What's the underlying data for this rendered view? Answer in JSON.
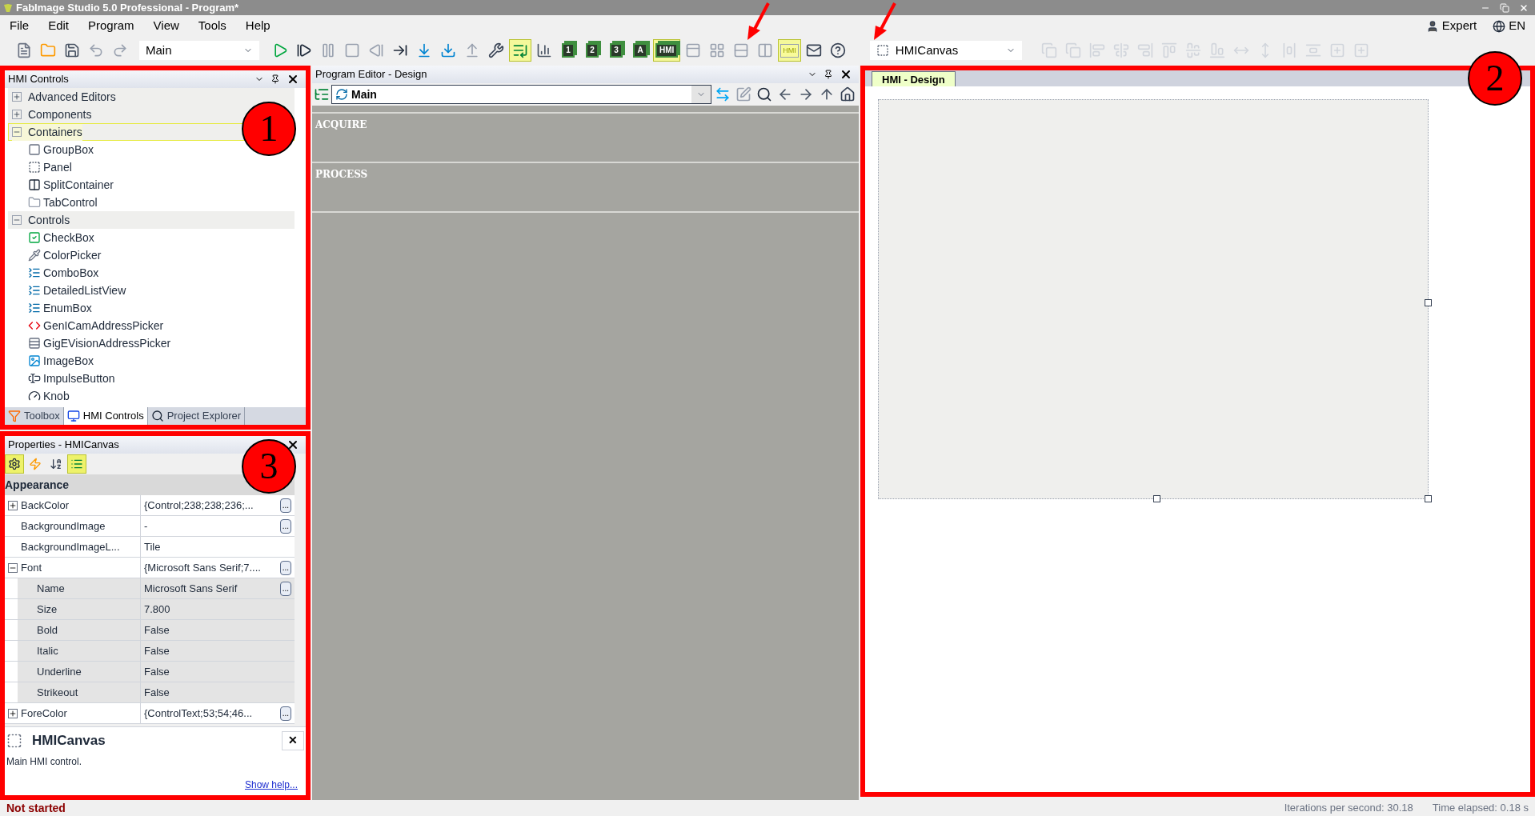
{
  "window": {
    "title": "FabImage Studio 5.0 Professional - Program*"
  },
  "menu": [
    "File",
    "Edit",
    "Program",
    "View",
    "Tools",
    "Help"
  ],
  "user": {
    "role": "Expert",
    "language": "EN"
  },
  "toolbar": {
    "left": [
      {
        "kind": "new",
        "selected": false
      },
      {
        "kind": "open",
        "selected": false
      },
      {
        "kind": "save",
        "selected": false
      },
      {
        "kind": "undo",
        "selected": false
      },
      {
        "kind": "redo",
        "selected": false
      }
    ],
    "program_dropdown": "Main",
    "middle": [
      {
        "kind": "run",
        "selected": false
      },
      {
        "kind": "step",
        "selected": false
      },
      {
        "kind": "pause",
        "selected": false
      },
      {
        "kind": "stop",
        "selected": false
      },
      {
        "kind": "back",
        "selected": false
      },
      {
        "kind": "iterate",
        "selected": false
      },
      {
        "kind": "step_in",
        "selected": false
      },
      {
        "kind": "step_over",
        "selected": false
      },
      {
        "kind": "step_out",
        "selected": false
      },
      {
        "kind": "wrench",
        "selected": false
      },
      {
        "kind": "export",
        "selected": true
      },
      {
        "kind": "chart",
        "selected": false
      },
      {
        "kind": "layout",
        "label": "1",
        "selected": false
      },
      {
        "kind": "layout",
        "label": "2",
        "selected": false
      },
      {
        "kind": "layout",
        "label": "3",
        "selected": false
      },
      {
        "kind": "layout",
        "label": "A",
        "selected": false
      },
      {
        "kind": "layout",
        "label": "HMI",
        "selected": true
      },
      {
        "kind": "single",
        "selected": false
      },
      {
        "kind": "grid",
        "selected": false
      },
      {
        "kind": "rows",
        "selected": false
      },
      {
        "kind": "cols",
        "selected": false
      },
      {
        "kind": "hmi_view",
        "label": "HMI",
        "selected": true
      },
      {
        "kind": "mail",
        "selected": false
      },
      {
        "kind": "help",
        "selected": false
      }
    ],
    "object_dropdown": "HMICanvas",
    "right": [
      {
        "kind": "front",
        "selected": false
      },
      {
        "kind": "back_order",
        "selected": false
      },
      {
        "kind": "align_left",
        "selected": false
      },
      {
        "kind": "align_center",
        "selected": false
      },
      {
        "kind": "align_right",
        "selected": false
      },
      {
        "kind": "align_top",
        "selected": false
      },
      {
        "kind": "align_middle",
        "selected": false
      },
      {
        "kind": "align_bottom",
        "selected": false
      },
      {
        "kind": "same_width",
        "selected": false
      },
      {
        "kind": "same_height",
        "selected": false
      },
      {
        "kind": "space_h",
        "selected": false
      },
      {
        "kind": "space_v",
        "selected": false
      },
      {
        "kind": "center_h",
        "selected": false
      },
      {
        "kind": "center_v",
        "selected": false
      }
    ]
  },
  "hmi_controls": {
    "title": "HMI Controls",
    "groups": [
      {
        "label": "Advanced Editors",
        "expanded": false,
        "selected": false
      },
      {
        "label": "Components",
        "expanded": false,
        "selected": false
      },
      {
        "label": "Containers",
        "expanded": true,
        "selected": true,
        "children": [
          {
            "label": "GroupBox",
            "kind": "groupbox"
          },
          {
            "label": "Panel",
            "kind": "panel"
          },
          {
            "label": "SplitContainer",
            "kind": "split"
          },
          {
            "label": "TabControl",
            "kind": "tab"
          }
        ]
      },
      {
        "label": "Controls",
        "expanded": true,
        "selected": false,
        "children": [
          {
            "label": "CheckBox",
            "kind": "checkbox"
          },
          {
            "label": "ColorPicker",
            "kind": "colorpicker"
          },
          {
            "label": "ComboBox",
            "kind": "list"
          },
          {
            "label": "DetailedListView",
            "kind": "list"
          },
          {
            "label": "EnumBox",
            "kind": "list"
          },
          {
            "label": "GenICamAddressPicker",
            "kind": "code"
          },
          {
            "label": "GigEVisionAddressPicker",
            "kind": "striped"
          },
          {
            "label": "ImageBox",
            "kind": "image"
          },
          {
            "label": "ImpulseButton",
            "kind": "textbox"
          },
          {
            "label": "Knob",
            "kind": "dial"
          }
        ]
      }
    ],
    "tabs": [
      {
        "label": "Toolbox",
        "kind": "funnel",
        "selected": false
      },
      {
        "label": "HMI Controls",
        "kind": "monitor",
        "selected": true
      },
      {
        "label": "Project Explorer",
        "kind": "magnifier",
        "selected": false
      }
    ]
  },
  "properties": {
    "title": "Properties - HMICanvas",
    "toolbar": [
      {
        "kind": "gear",
        "selected": true
      },
      {
        "kind": "lightning",
        "selected": false
      },
      {
        "kind": "sort",
        "selected": false
      },
      {
        "kind": "categorized",
        "selected": true
      }
    ],
    "category": "Appearance",
    "rows": [
      {
        "name": "BackColor",
        "value": "{Control;238;238;236;...",
        "expanded": false,
        "button": "..."
      },
      {
        "name": "BackgroundImage",
        "value": "-",
        "button": "..."
      },
      {
        "name": "BackgroundImageL...",
        "value": "Tile"
      },
      {
        "name": "Font",
        "value": "{Microsoft Sans Serif;7....",
        "expanded": true,
        "button": "...",
        "children": [
          {
            "name": "Name",
            "value": "Microsoft Sans Serif",
            "button": "..."
          },
          {
            "name": "Size",
            "value": "7.800"
          },
          {
            "name": "Bold",
            "value": "False"
          },
          {
            "name": "Italic",
            "value": "False"
          },
          {
            "name": "Underline",
            "value": "False"
          },
          {
            "name": "Strikeout",
            "value": "False"
          }
        ]
      },
      {
        "name": "ForeColor",
        "value": "{ControlText;53;54;46...",
        "expanded": false,
        "button": "..."
      }
    ],
    "description": {
      "title": "HMICanvas",
      "close": "✕",
      "text": "Main HMI control.",
      "link": "Show help..."
    }
  },
  "program_editor": {
    "title": "Program Editor - Design",
    "dropdown": "Main",
    "sections": [
      "ACQUIRE",
      "PROCESS"
    ]
  },
  "hmi_design": {
    "tabs": [
      {
        "label": "HMI - Design",
        "selected": true
      }
    ]
  },
  "annotations": [
    {
      "label": "1"
    },
    {
      "label": "2"
    },
    {
      "label": "3"
    }
  ],
  "status_bar": {
    "state": "Not started",
    "iterations": "Iterations per second: 30.18",
    "elapsed": "Time elapsed: 0.18 s"
  }
}
